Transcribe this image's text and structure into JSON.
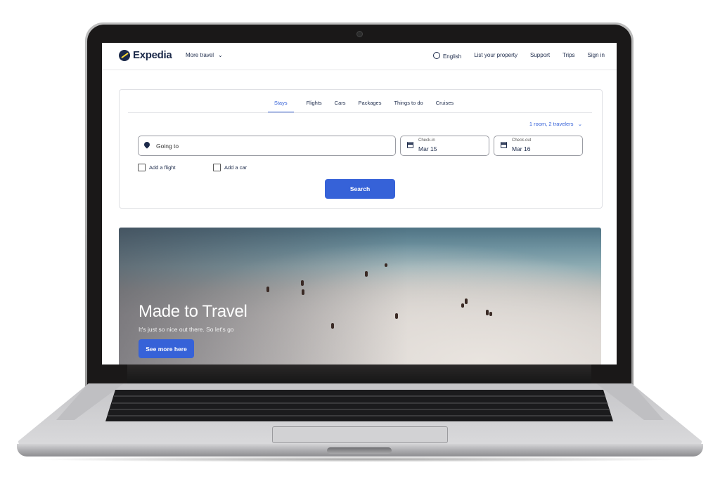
{
  "header": {
    "brand": "Expedia",
    "more_travel": "More travel",
    "nav": {
      "language": "English",
      "list_property": "List your property",
      "support": "Support",
      "trips": "Trips",
      "sign_in": "Sign in"
    }
  },
  "search_card": {
    "tabs": [
      {
        "label": "Stays",
        "active": true
      },
      {
        "label": "Flights",
        "active": false
      },
      {
        "label": "Cars",
        "active": false
      },
      {
        "label": "Packages",
        "active": false
      },
      {
        "label": "Things to do",
        "active": false
      },
      {
        "label": "Cruises",
        "active": false
      }
    ],
    "travelers": "1 room, 2 travelers",
    "destination_placeholder": "Going to",
    "check_in": {
      "label": "Check-in",
      "value": "Mar 15"
    },
    "check_out": {
      "label": "Check-out",
      "value": "Mar 16"
    },
    "add_flight": "Add a flight",
    "add_car": "Add a car",
    "search_button": "Search"
  },
  "hero": {
    "title": "Made to Travel",
    "subtitle": "It's just so nice out there. So let's go",
    "button": "See more here"
  },
  "colors": {
    "brand_navy": "#1c2a4a",
    "accent_blue": "#3662d8",
    "logo_yellow": "#fddb32"
  }
}
